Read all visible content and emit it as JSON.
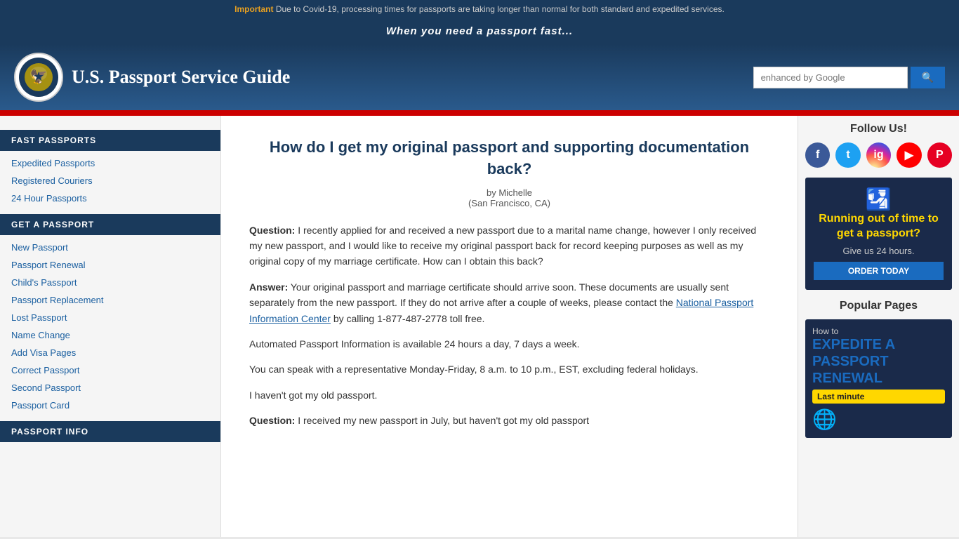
{
  "topbar": {
    "important_label": "Important",
    "notice": "Due to Covid-19, processing times for passports are taking longer than normal for both standard and expedited services."
  },
  "tagline": "When you need a passport fast...",
  "header": {
    "site_title": "U.S. Passport Service Guide",
    "search_placeholder": "enhanced by Google",
    "search_button_label": "q"
  },
  "sidebar": {
    "fast_passports_title": "FAST PASSPORTS",
    "fast_passport_links": [
      {
        "label": "Expedited Passports",
        "href": "#"
      },
      {
        "label": "Registered Couriers",
        "href": "#"
      },
      {
        "label": "24 Hour Passports",
        "href": "#"
      }
    ],
    "get_passport_title": "GET A PASSPORT",
    "get_passport_links": [
      {
        "label": "New Passport",
        "href": "#"
      },
      {
        "label": "Passport Renewal",
        "href": "#"
      },
      {
        "label": "Child's Passport",
        "href": "#"
      },
      {
        "label": "Passport Replacement",
        "href": "#"
      },
      {
        "label": "Lost Passport",
        "href": "#"
      },
      {
        "label": "Name Change",
        "href": "#"
      },
      {
        "label": "Add Visa Pages",
        "href": "#"
      },
      {
        "label": "Correct Passport",
        "href": "#"
      },
      {
        "label": "Second Passport",
        "href": "#"
      },
      {
        "label": "Passport Card",
        "href": "#"
      }
    ],
    "passport_info_title": "PASSPORT INFO"
  },
  "content": {
    "title": "How do I get my original passport and supporting documentation back?",
    "byline": "by Michelle",
    "location": "(San Francisco, CA)",
    "question_label": "Question:",
    "question_text": "I recently applied for and received a new passport due to a marital name change, however I only received my new passport, and I would like to receive my original passport back for record keeping purposes as well as my original copy of my marriage certificate. How can I obtain this back?",
    "answer_label": "Answer:",
    "answer_text": "Your original passport and marriage certificate should arrive soon. These documents are usually sent separately from the new passport. If they do not arrive after a couple of weeks, please contact the",
    "npic_link": "National Passport Information Center",
    "answer_text2": "by calling 1-877-487-2778 toll free.",
    "automated_info": "Automated Passport Information is available 24 hours a day, 7 days a week.",
    "speak_info": "You can speak with a representative Monday-Friday, 8 a.m. to 10 p.m., EST, excluding federal holidays.",
    "old_passport_text": "I haven't got my old passport.",
    "question2_label": "Question:",
    "question2_text": "I received my new passport in July, but haven't got my old passport"
  },
  "right_sidebar": {
    "follow_title": "Follow Us!",
    "social": [
      {
        "name": "facebook",
        "label": "f"
      },
      {
        "name": "twitter",
        "label": "t"
      },
      {
        "name": "instagram",
        "label": "in"
      },
      {
        "name": "youtube",
        "label": "▶"
      },
      {
        "name": "pinterest",
        "label": "P"
      }
    ],
    "ad1": {
      "text": "Running out of time to get a passport?",
      "subtext": "Give us 24 hours.",
      "button": "ORDER TODAY"
    },
    "popular_title": "Popular Pages",
    "ad2": {
      "how_to": "How to",
      "expedite_text": "EXPEDITE A PASSPORT RENEWAL",
      "badge": "Last minute"
    }
  }
}
